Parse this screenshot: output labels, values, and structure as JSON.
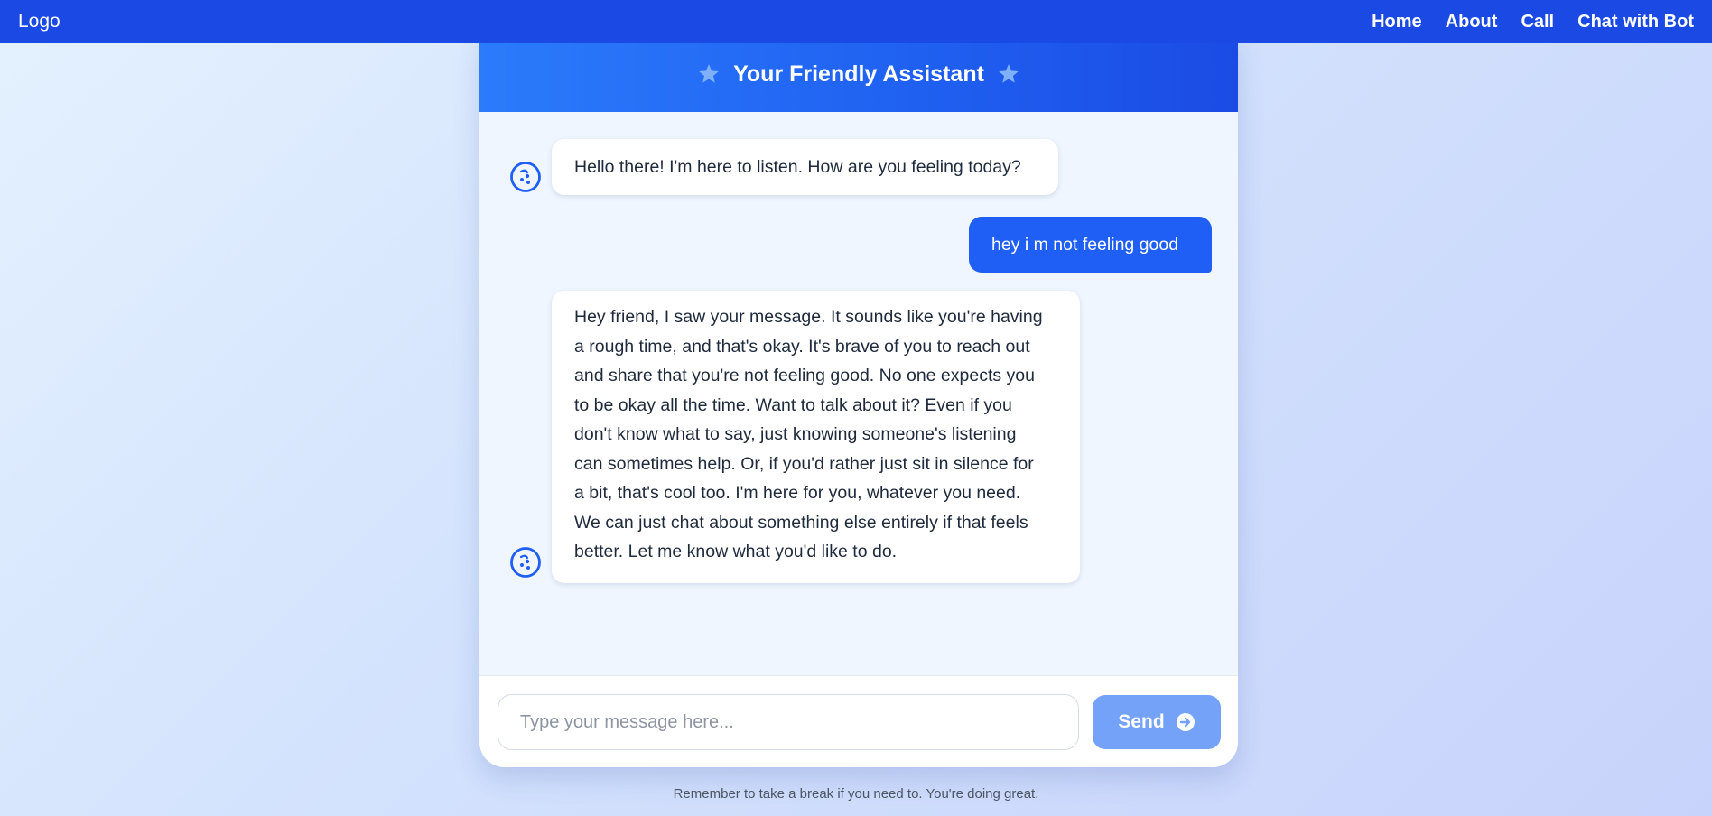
{
  "nav": {
    "logo": "Logo",
    "links": [
      "Home",
      "About",
      "Call",
      "Chat with Bot"
    ]
  },
  "chat": {
    "title": "Your Friendly Assistant",
    "messages": [
      {
        "sender": "bot",
        "text": "Hello there! I'm here to listen. How are you feeling today?"
      },
      {
        "sender": "user",
        "text": "hey i m not feeling good"
      },
      {
        "sender": "bot",
        "lines": [
          "Hey friend, I saw your message. It sounds like you're having",
          "a rough time, and that's okay. It's brave of you to reach out",
          "and share that you're not feeling good. No one expects you",
          "to be okay all the time. Want to talk about it? Even if you",
          "don't know what to say, just knowing someone's listening",
          "can sometimes help. Or, if you'd rather just sit in silence for",
          "a bit, that's cool too. I'm here for you, whatever you need.",
          "We can just chat about something else entirely if that feels",
          "better. Let me know what you'd like to do."
        ]
      }
    ],
    "input_placeholder": "Type your message here...",
    "input_value": "",
    "send_label": "Send"
  },
  "footer": {
    "note": "Remember to take a break if you need to. You're doing great."
  },
  "colors": {
    "nav_bg": "#1a4ae3",
    "header_gradient_start": "#2b7bfb",
    "header_gradient_end": "#1b4be4",
    "user_bubble": "#1f5ff6",
    "send_button": "#74a2f8",
    "avatar_accent": "#1f5ff6"
  },
  "icons": {
    "header_star": "star-icon",
    "bot_avatar": "bot-face-icon",
    "send": "arrow-circle-right-icon"
  }
}
